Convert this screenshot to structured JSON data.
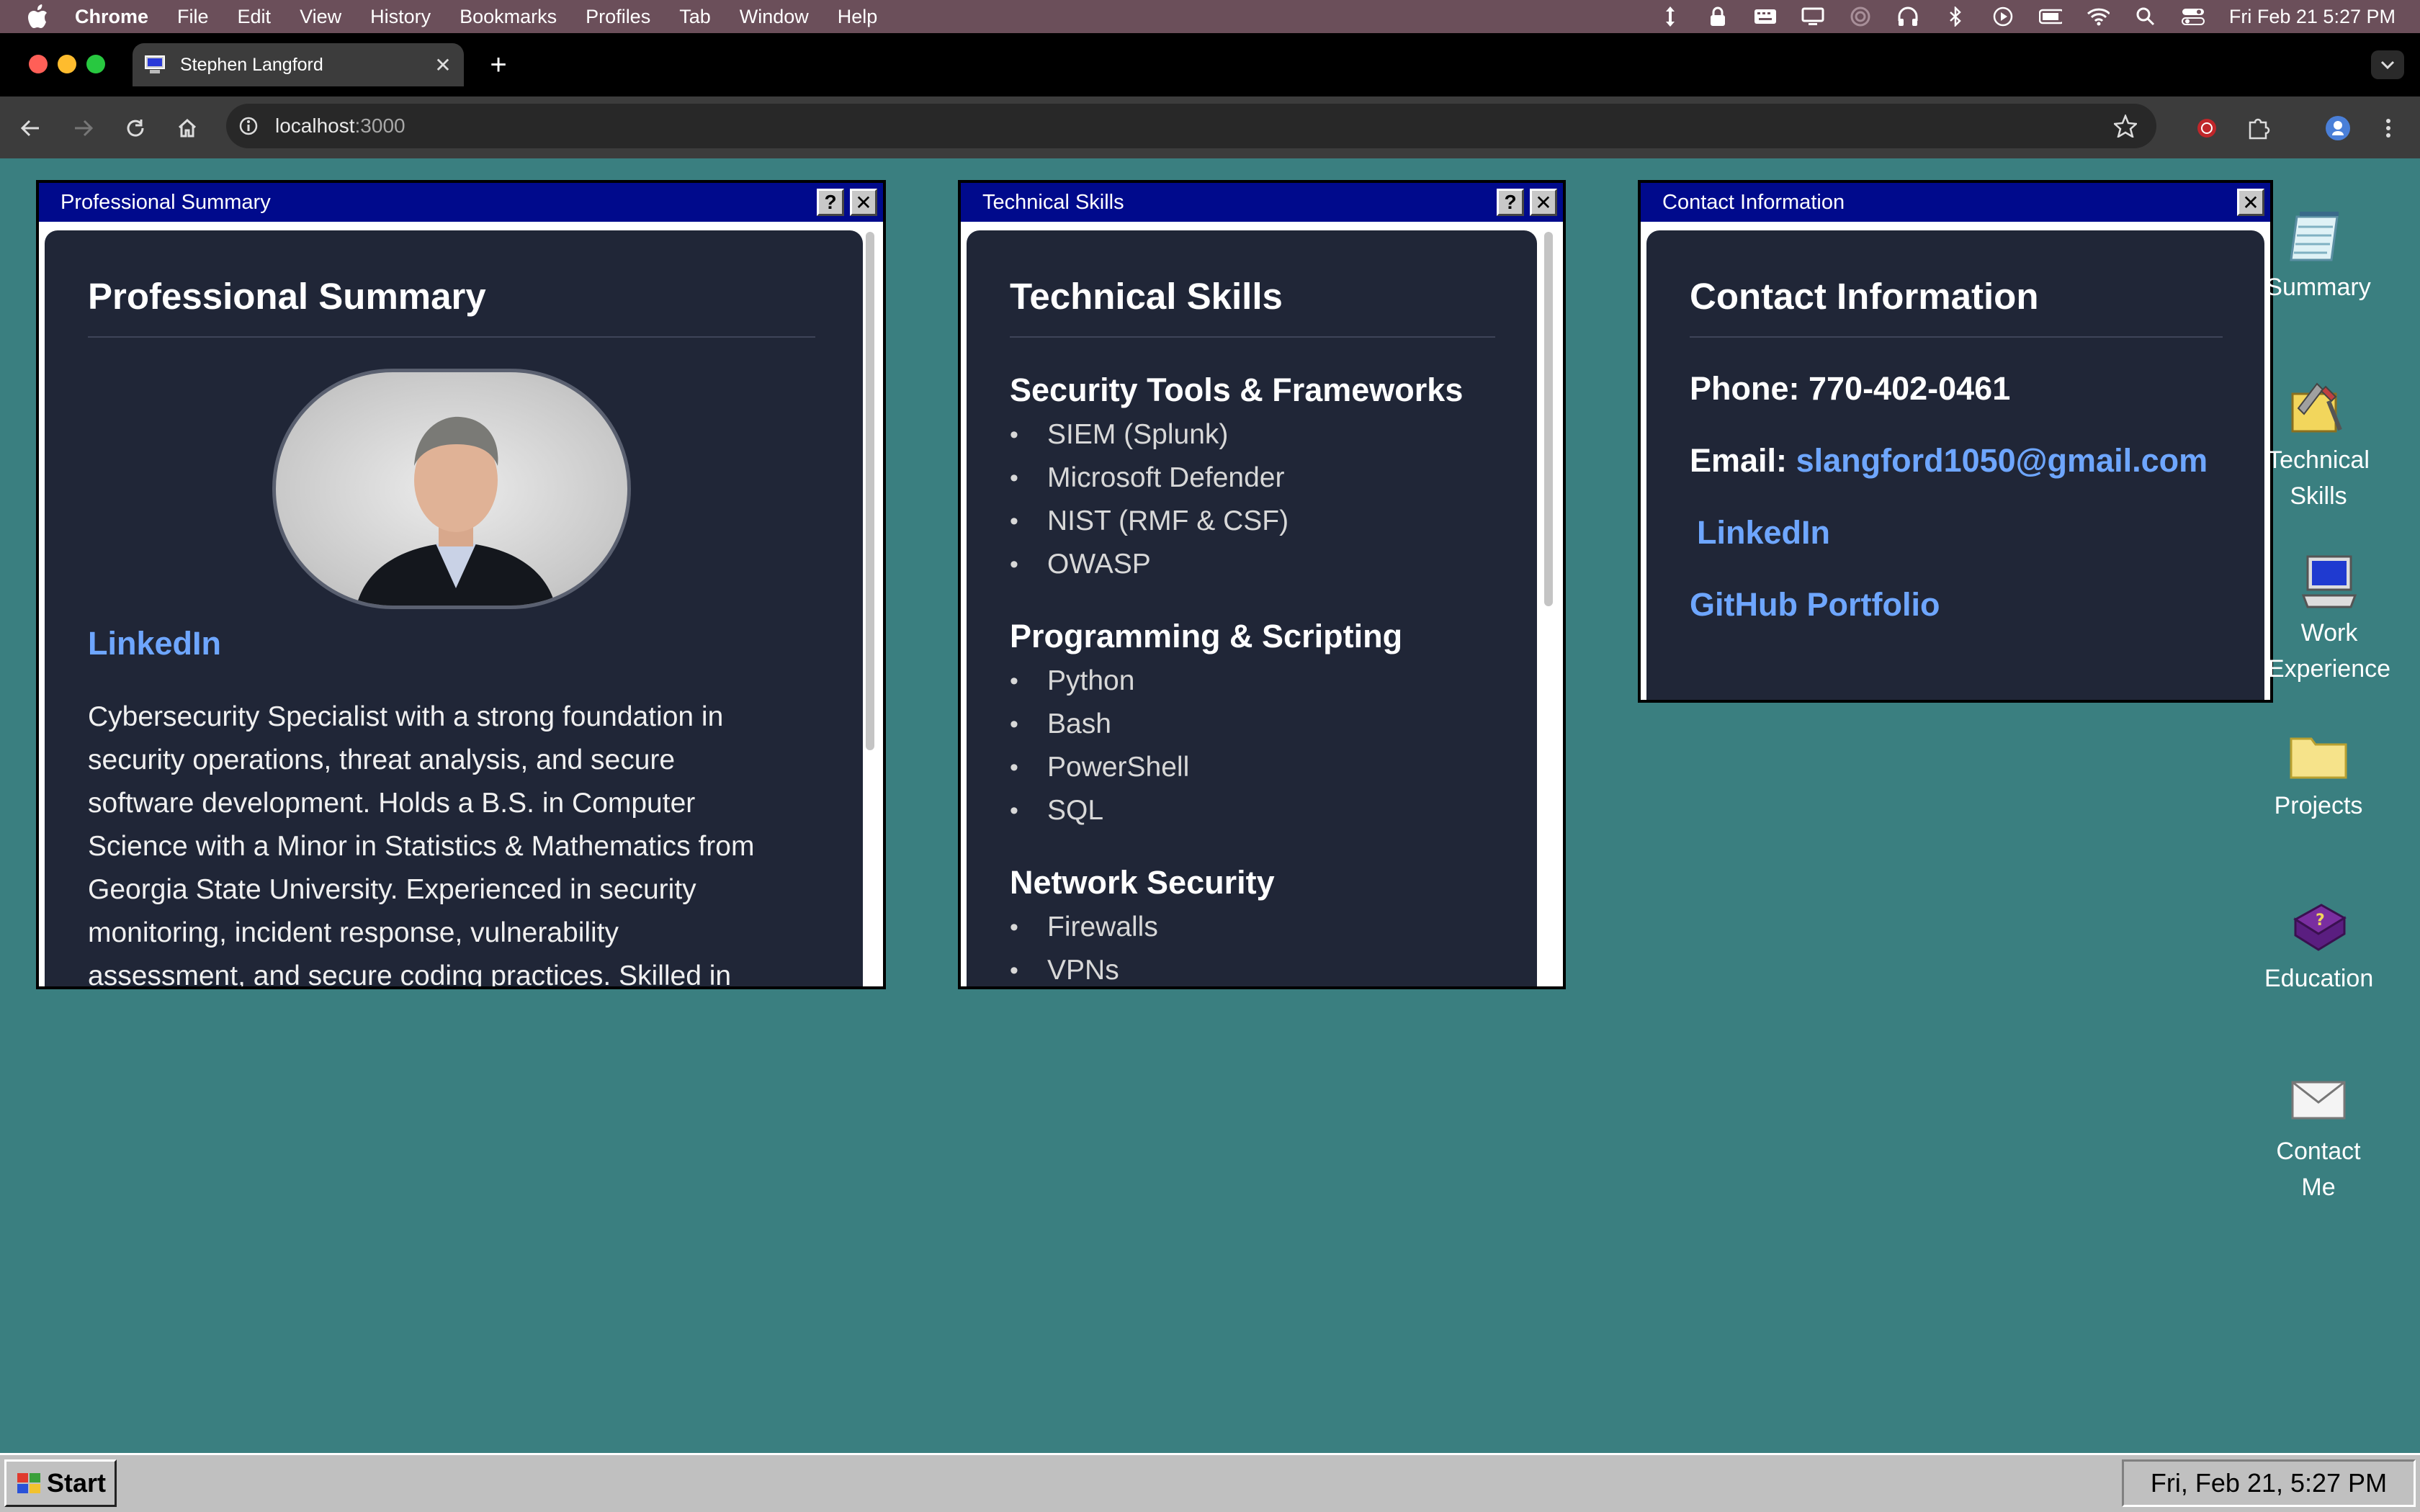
{
  "menubar": {
    "app_name": "Chrome",
    "items": [
      "File",
      "Edit",
      "View",
      "History",
      "Bookmarks",
      "Profiles",
      "Tab",
      "Window",
      "Help"
    ],
    "clock": "Fri Feb 21  5:27 PM"
  },
  "browser": {
    "tab_title": "Stephen Langford",
    "url_host": "localhost",
    "url_port": ":3000"
  },
  "windows": {
    "summary": {
      "title": "Professional Summary",
      "heading": "Professional Summary",
      "linkedin_label": "LinkedIn",
      "paragraph_lines": [
        "Cybersecurity Specialist with a strong foundation in",
        "security operations, threat analysis, and secure",
        "software development. Holds a B.S. in Computer",
        "Science with a Minor in Statistics & Mathematics from",
        "Georgia State University. Experienced in security",
        "monitoring, incident response, vulnerability",
        "assessment, and secure coding practices. Skilled in"
      ]
    },
    "skills": {
      "title": "Technical Skills",
      "heading": "Technical Skills",
      "sections": [
        {
          "heading": "Security Tools & Frameworks",
          "items": [
            "SIEM (Splunk)",
            "Microsoft Defender",
            "NIST (RMF & CSF)",
            "OWASP"
          ]
        },
        {
          "heading": "Programming & Scripting",
          "items": [
            "Python",
            "Bash",
            "PowerShell",
            "SQL"
          ]
        },
        {
          "heading": "Network Security",
          "items": [
            "Firewalls",
            "VPNs"
          ]
        }
      ]
    },
    "contact": {
      "title": "Contact Information",
      "heading": "Contact Information",
      "phone_label": "Phone: 770-402-0461",
      "email_label": "Email:",
      "email_value": "slangford1050@gmail.com",
      "linkedin_label": "LinkedIn",
      "github_label": "GitHub Portfolio"
    }
  },
  "desktop_icons": [
    {
      "label": "Summary",
      "icon": "notepad-icon"
    },
    {
      "label": "Technical Skills",
      "icon": "tools-icon"
    },
    {
      "label": "Work Experience",
      "icon": "computer-icon"
    },
    {
      "label": "Projects",
      "icon": "folder-icon"
    },
    {
      "label": "Education",
      "icon": "help-book-icon"
    },
    {
      "label": "Contact Me",
      "icon": "envelope-icon"
    }
  ],
  "taskbar": {
    "start_label": "Start",
    "clock": "Fri, Feb 21, 5:27 PM"
  },
  "colors": {
    "desktop": "#3a7f80",
    "titlebar": "#000a8c",
    "content_bg": "#202637",
    "link": "#6ea6ff"
  }
}
